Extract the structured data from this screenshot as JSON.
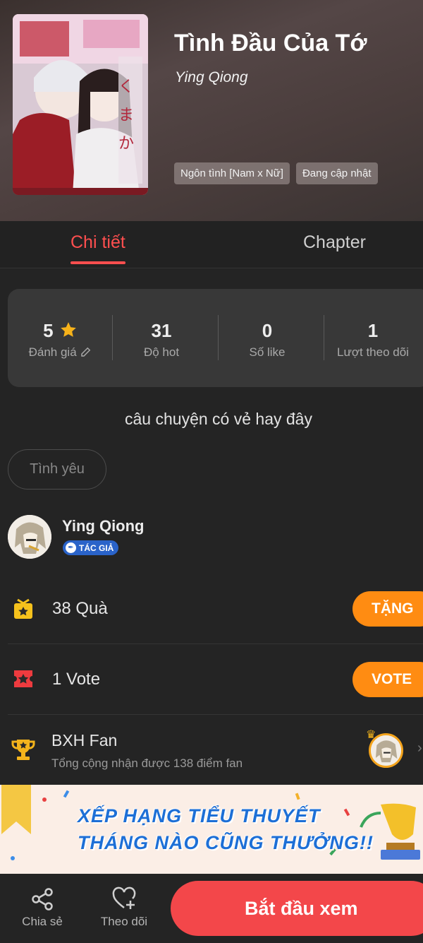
{
  "header": {
    "title": "Tình Đầu Của Tớ",
    "author": "Ying Qiong",
    "tags": [
      "Ngôn tình [Nam x Nữ]",
      "Đang cập nhật"
    ],
    "cover_icon": "manga-cover-image"
  },
  "tabs": [
    {
      "label": "Chi tiết",
      "active": true
    },
    {
      "label": "Chapter",
      "active": false
    }
  ],
  "stats": [
    {
      "value": "5",
      "label": "Đánh giá",
      "icon": "star-icon"
    },
    {
      "value": "31",
      "label": "Độ hot"
    },
    {
      "value": "0",
      "label": "Số like"
    },
    {
      "value": "1",
      "label": "Lượt theo dõi"
    }
  ],
  "description": "câu chuyện có vẻ hay đây",
  "genre_chip": "Tình yêu",
  "author_section": {
    "name": "Ying Qiong",
    "badge": "TÁC GIẢ"
  },
  "gifts": {
    "text": "38  Quà",
    "button": "TẶNG"
  },
  "votes": {
    "text": "1  Vote",
    "button": "VOTE"
  },
  "fan_ranking": {
    "title": "BXH Fan",
    "subtitle": "Tổng cộng nhận được 138 điểm fan"
  },
  "banner": {
    "line1": "XẾP HẠNG TIỂU THUYẾT",
    "line2": "THÁNG NÀO CŨNG THƯỞNG!!"
  },
  "bottom_bar": {
    "share": "Chia sẻ",
    "follow": "Theo dõi",
    "start": "Bắt đầu xem"
  },
  "colors": {
    "accent_red": "#ff4f4f",
    "orange": "#ff8c12",
    "start_button": "#f3474a",
    "background": "#242424"
  }
}
